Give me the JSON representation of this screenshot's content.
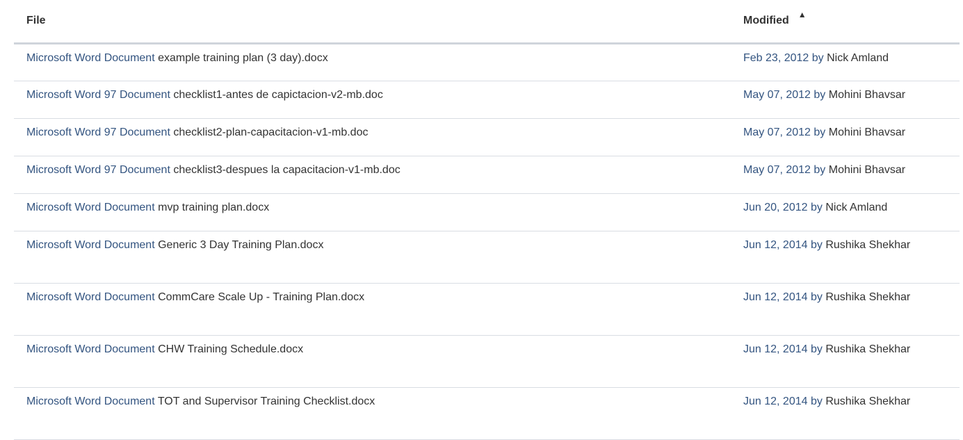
{
  "header": {
    "file_label": "File",
    "modified_label": "Modified",
    "sort_icon": "triangle-up-icon"
  },
  "files": [
    {
      "type": "Microsoft Word Document",
      "name": "example training plan (3 day).docx",
      "date": "Feb 23, 2012",
      "by": "by",
      "author": "Nick Amland"
    },
    {
      "type": "Microsoft Word 97 Document",
      "name": "checklist1-antes de capictacion-v2-mb.doc",
      "date": "May 07, 2012",
      "by": "by",
      "author": "Mohini Bhavsar"
    },
    {
      "type": "Microsoft Word 97 Document",
      "name": "checklist2-plan-capacitacion-v1-mb.doc",
      "date": "May 07, 2012",
      "by": "by",
      "author": "Mohini Bhavsar"
    },
    {
      "type": "Microsoft Word 97 Document",
      "name": "checklist3-despues la capacitacion-v1-mb.doc",
      "date": "May 07, 2012",
      "by": "by",
      "author": "Mohini Bhavsar"
    },
    {
      "type": "Microsoft Word Document",
      "name": "mvp training plan.docx",
      "date": "Jun 20, 2012",
      "by": "by",
      "author": "Nick Amland"
    },
    {
      "type": "Microsoft Word Document",
      "name": "Generic 3 Day Training Plan.docx",
      "date": "Jun 12, 2014",
      "by": "by",
      "author": "Rushika Shekhar"
    },
    {
      "type": "Microsoft Word Document",
      "name": "CommCare Scale Up - Training Plan.docx",
      "date": "Jun 12, 2014",
      "by": "by",
      "author": "Rushika Shekhar"
    },
    {
      "type": "Microsoft Word Document",
      "name": "CHW Training Schedule.docx",
      "date": "Jun 12, 2014",
      "by": "by",
      "author": "Rushika Shekhar"
    },
    {
      "type": "Microsoft Word Document",
      "name": "TOT and Supervisor Training Checklist.docx",
      "date": "Jun 12, 2014",
      "by": "by",
      "author": "Rushika Shekhar"
    }
  ]
}
